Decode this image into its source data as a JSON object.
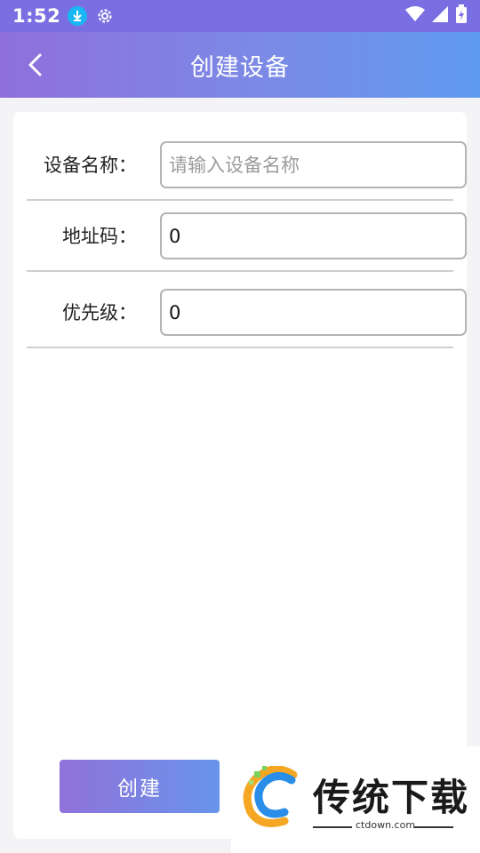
{
  "status_bar": {
    "time": "1:52",
    "icons": [
      "download-icon",
      "settings-icon",
      "wifi-icon",
      "cell-signal-icon",
      "battery-charging-icon"
    ]
  },
  "header": {
    "title": "创建设备",
    "back_icon": "chevron-left-icon"
  },
  "form": {
    "fields": [
      {
        "label": "设备名称：",
        "value": "",
        "placeholder": "请输入设备名称"
      },
      {
        "label": "地址码：",
        "value": "0",
        "placeholder": ""
      },
      {
        "label": "优先级：",
        "value": "0",
        "placeholder": ""
      }
    ]
  },
  "actions": {
    "create_label": "创建"
  },
  "watermark": {
    "brand": "传统下载",
    "url": "ctdown.com"
  },
  "colors": {
    "status_bar": "#7a6fe2",
    "header_start": "#8f6fdc",
    "header_end": "#5f9bf0",
    "button_start": "#9072da",
    "button_end": "#6894eb",
    "background": "#f4f4f6"
  }
}
